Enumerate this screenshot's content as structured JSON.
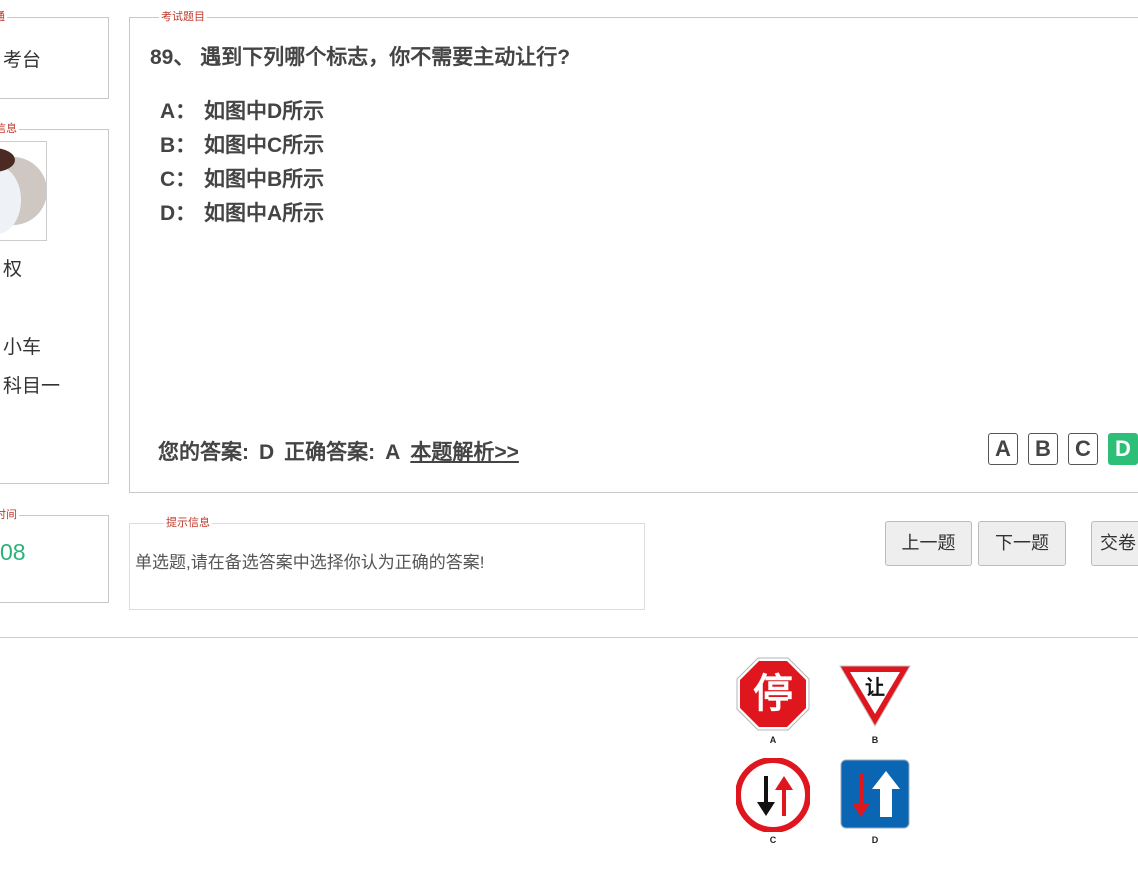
{
  "left": {
    "top_legend": "点通",
    "top_text": "考台",
    "info_legend": "信息",
    "name_partial": "权",
    "car_type": "小车",
    "subject": "科目一",
    "time_legend": "时间",
    "time_value": "08"
  },
  "question": {
    "legend": "考试题目",
    "title": "89、 遇到下列哪个标志，你不需要主动让行?",
    "options": [
      {
        "key": "A：",
        "text": "如图中D所示"
      },
      {
        "key": "B：",
        "text": "如图中C所示"
      },
      {
        "key": "C：",
        "text": "如图中B所示"
      },
      {
        "key": "D：",
        "text": "如图中A所示"
      }
    ],
    "your_answer_label": "您的答案:",
    "your_answer": "D",
    "correct_answer_label": "正确答案:",
    "correct_answer": "A",
    "analysis_link": "本题解析>>",
    "answer_buttons": [
      "A",
      "B",
      "C",
      "D"
    ],
    "selected": "D"
  },
  "hint": {
    "legend": "提示信息",
    "text": "单选题,请在备选答案中选择你认为正确的答案!"
  },
  "nav": {
    "prev": "上一题",
    "next": "下一题",
    "submit": "交卷"
  },
  "signs": {
    "a_text": "停",
    "b_text": "让",
    "labels": [
      "A",
      "B",
      "C",
      "D"
    ]
  },
  "colors": {
    "accent_green": "#2dbf77",
    "legend_red": "#c0392b",
    "sign_red": "#e0161f",
    "sign_blue": "#0a66b3"
  }
}
